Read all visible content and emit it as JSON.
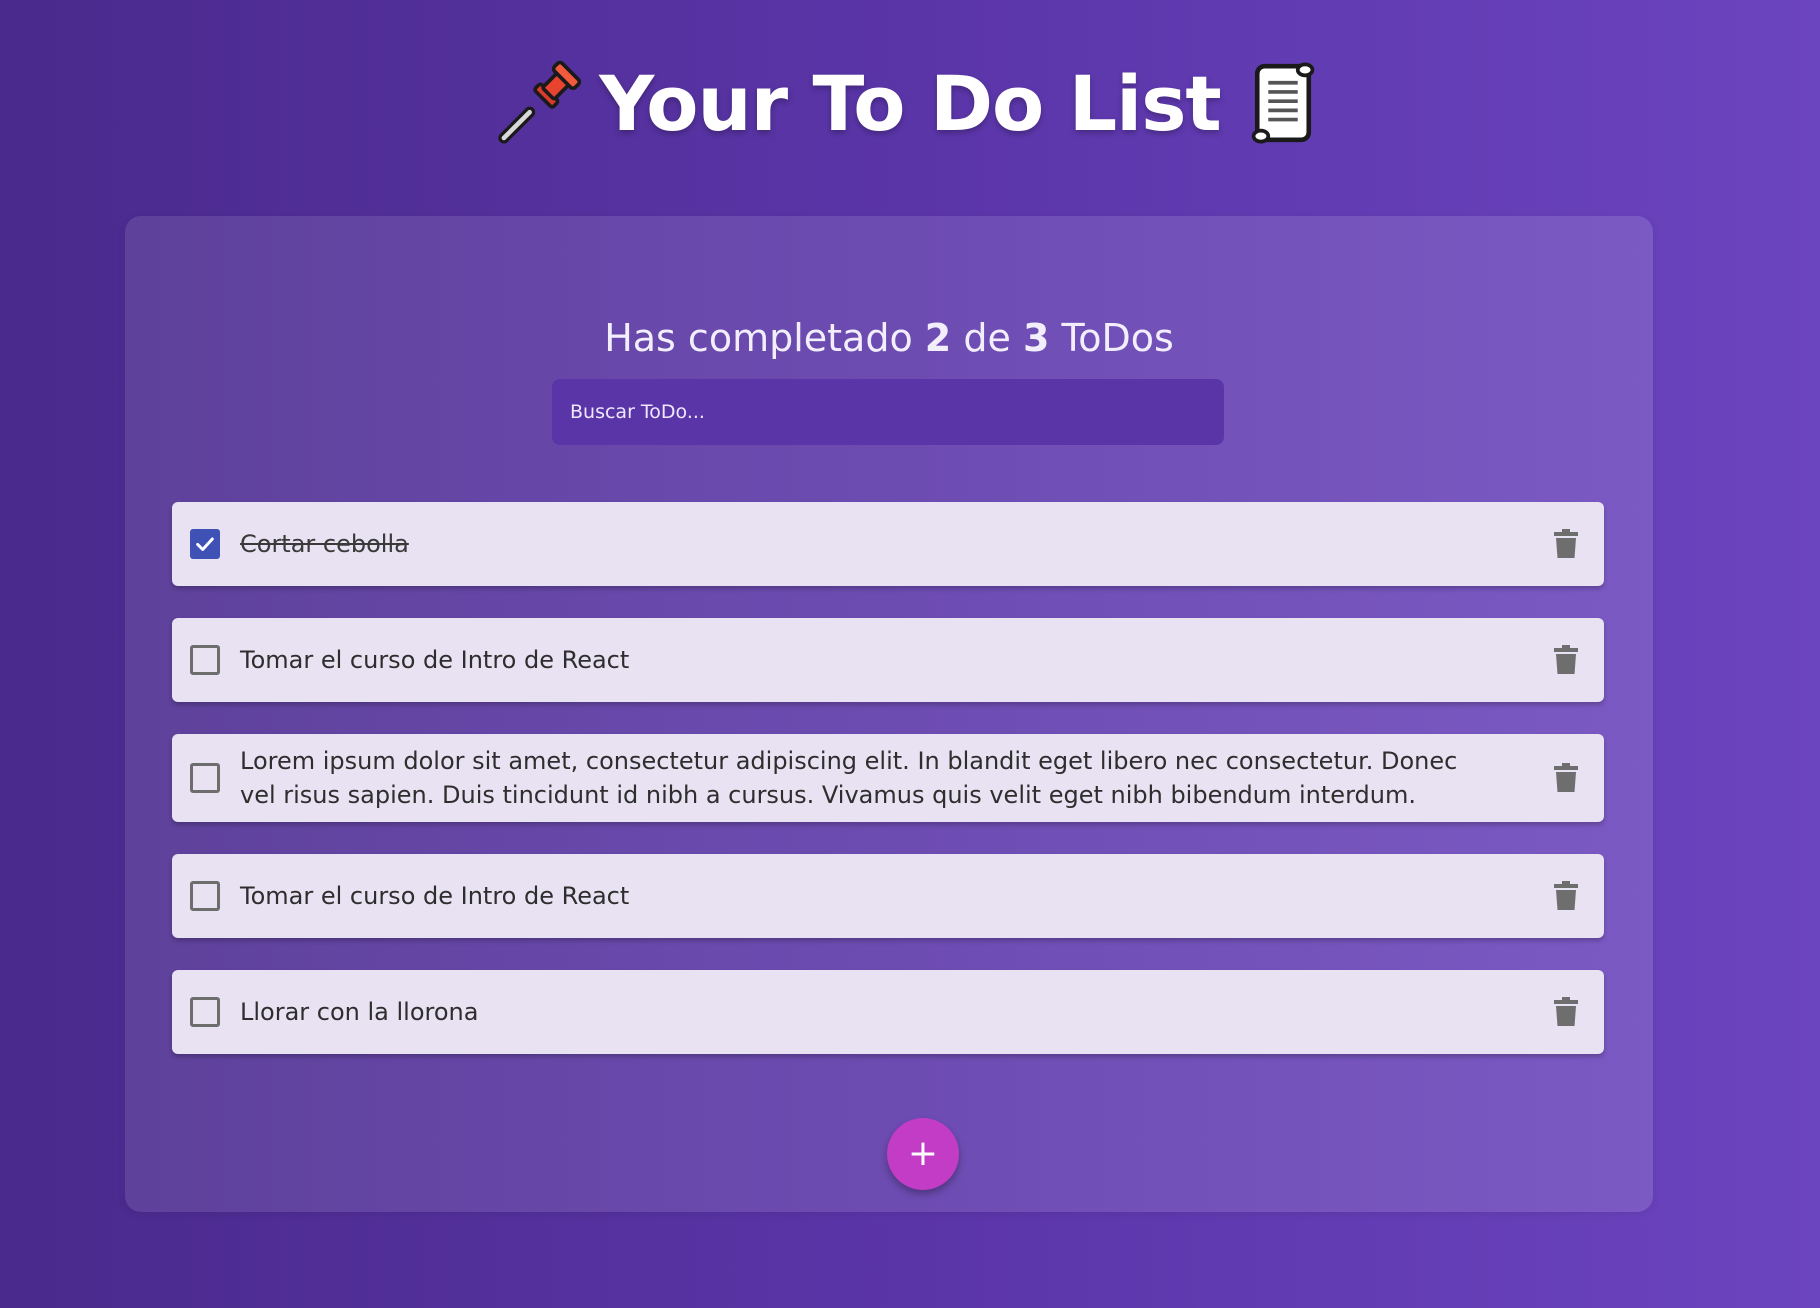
{
  "header": {
    "title": "Your To Do List",
    "left_icon": "pushpin-icon",
    "right_icon": "scroll-icon"
  },
  "counter": {
    "prefix": "Has completado",
    "completed": "2",
    "middle": "de",
    "total": "3",
    "suffix": "ToDos"
  },
  "search": {
    "placeholder": "Buscar ToDo..."
  },
  "todos": [
    {
      "text": "Cortar cebolla",
      "completed": true
    },
    {
      "text": "Tomar el curso de Intro de React",
      "completed": false
    },
    {
      "text": "Lorem ipsum dolor sit amet, consectetur adipiscing elit. In blandit eget libero nec consectetur. Donec vel risus sapien. Duis tincidunt id nibh a cursus. Vivamus quis velit eget nibh bibendum interdum.",
      "completed": false
    },
    {
      "text": "Tomar el curso de Intro de React",
      "completed": false
    },
    {
      "text": "Llorar con la llorona",
      "completed": false
    }
  ],
  "fab": {
    "label": "+"
  },
  "colors": {
    "background_start": "#4a2a8c",
    "background_end": "#6b44bf",
    "search_bg": "#5a35a8",
    "checkbox_checked": "#3f51b5",
    "fab": "#c23cc6",
    "item_bg": "#e8e2f2"
  }
}
